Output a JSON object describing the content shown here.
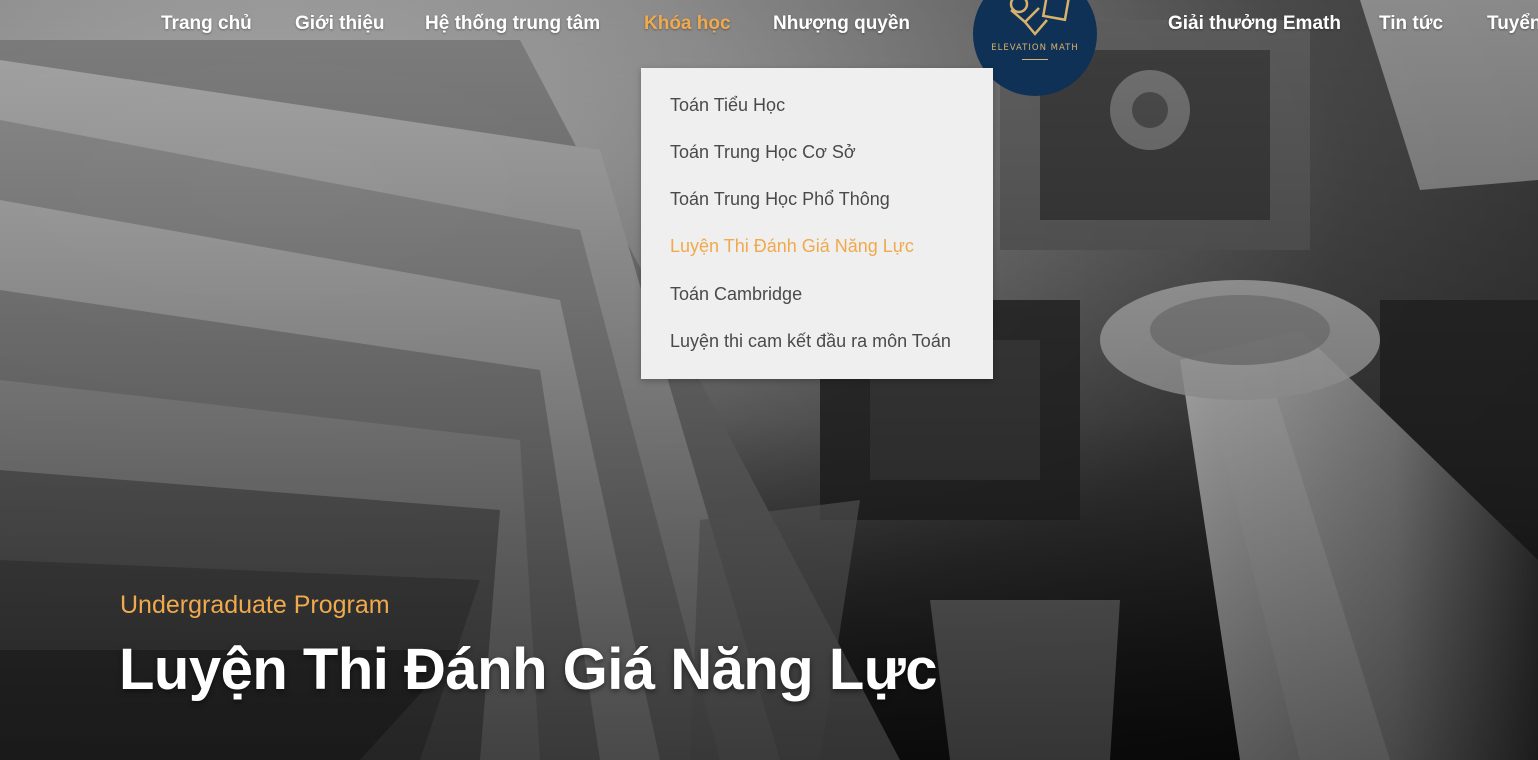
{
  "nav": {
    "items": [
      {
        "label": "Trang chủ"
      },
      {
        "label": "Giới thiệu"
      },
      {
        "label": "Hệ thống trung tâm"
      },
      {
        "label": "Khóa học"
      },
      {
        "label": "Nhượng quyền"
      },
      {
        "label": "Giải thưởng Emath"
      },
      {
        "label": "Tin tức"
      },
      {
        "label": "Tuyển"
      }
    ],
    "active": "Khóa học",
    "logo_text": "ELEVATION MATH"
  },
  "dropdown": {
    "items": [
      {
        "label": "Toán Tiểu Học"
      },
      {
        "label": "Toán Trung Học Cơ Sở"
      },
      {
        "label": "Toán Trung Học Phổ Thông"
      },
      {
        "label": "Luyện Thi Đánh Giá Năng Lực"
      },
      {
        "label": "Toán Cambridge"
      },
      {
        "label": "Luyện thi cam kết đầu ra môn Toán"
      }
    ],
    "active": "Luyện Thi Đánh Giá Năng Lực"
  },
  "hero": {
    "subtitle": "Undergraduate Program",
    "title": "Luyện Thi Đánh Giá Năng Lực"
  },
  "colors": {
    "accent": "#f0a94c",
    "logo_bg": "#0f3156",
    "dropdown_bg": "#efefef",
    "nav_text": "#ffffff"
  }
}
